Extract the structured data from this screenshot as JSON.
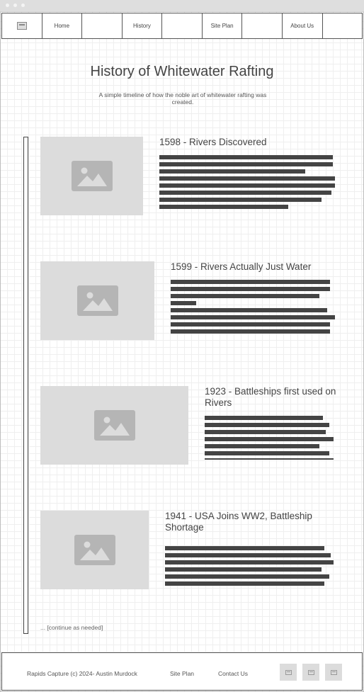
{
  "nav": {
    "items": [
      "Home",
      "History",
      "Site Plan",
      "About Us"
    ]
  },
  "header": {
    "title": "History of Whitewater Rafting",
    "subtitle": "A simple timeline of how the noble art of whitewater rafting was created."
  },
  "timeline": {
    "events": [
      {
        "title": "1598 - Rivers Discovered"
      },
      {
        "title": "1599 - Rivers Actually Just Water"
      },
      {
        "title": "1923 - Battleships first used on Rivers"
      },
      {
        "title": "1941 - USA Joins WW2, Battleship Shortage"
      }
    ],
    "continue_note": "... [continue as needed]"
  },
  "footer": {
    "copyright": "Rapids Capture (c) 2024- Austin Murdock",
    "site_plan": "Site Plan",
    "contact": "Contact Us"
  },
  "colors": {
    "placeholder": "#dcdcdc",
    "text_line": "#444444",
    "border": "#555555"
  }
}
